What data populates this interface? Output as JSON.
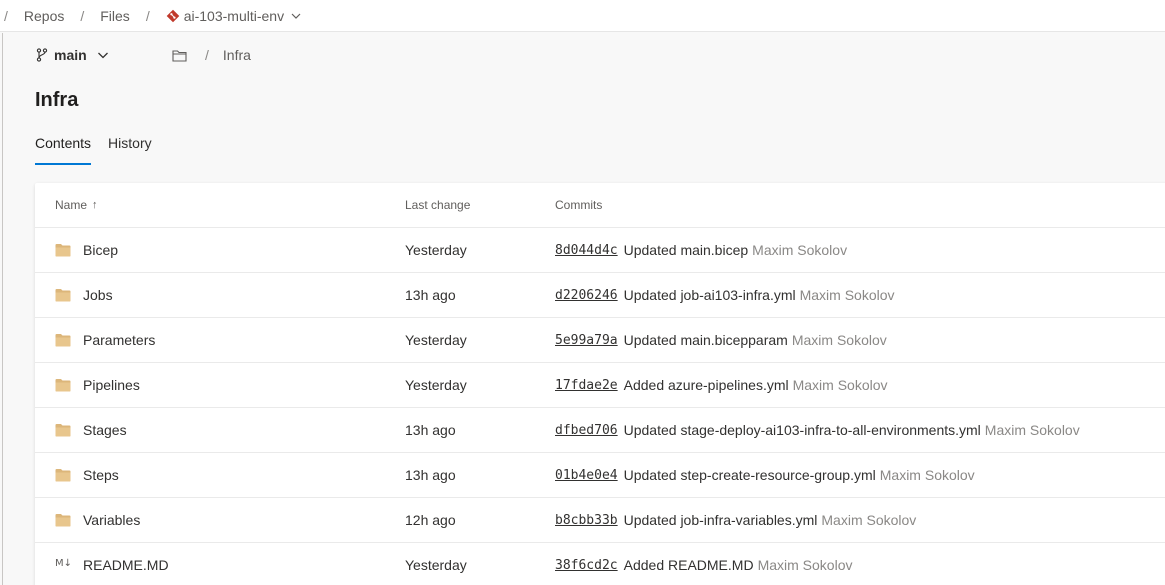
{
  "breadcrumb": {
    "repos": "Repos",
    "files": "Files",
    "repo_name": "ai-103-multi-env"
  },
  "branch": {
    "name": "main"
  },
  "path": {
    "folder": "Infra"
  },
  "page": {
    "title": "Infra"
  },
  "tabs": [
    {
      "label": "Contents",
      "active": true
    },
    {
      "label": "History",
      "active": false
    }
  ],
  "table": {
    "headers": {
      "name": "Name",
      "last_change": "Last change",
      "commits": "Commits"
    },
    "rows": [
      {
        "type": "folder",
        "name": "Bicep",
        "last_change": "Yesterday",
        "commit_id": "8d044d4c",
        "message": "Updated main.bicep",
        "author": "Maxim Sokolov"
      },
      {
        "type": "folder",
        "name": "Jobs",
        "last_change": "13h ago",
        "commit_id": "d2206246",
        "message": "Updated job-ai103-infra.yml",
        "author": "Maxim Sokolov"
      },
      {
        "type": "folder",
        "name": "Parameters",
        "last_change": "Yesterday",
        "commit_id": "5e99a79a",
        "message": "Updated main.bicepparam",
        "author": "Maxim Sokolov"
      },
      {
        "type": "folder",
        "name": "Pipelines",
        "last_change": "Yesterday",
        "commit_id": "17fdae2e",
        "message": "Added azure-pipelines.yml",
        "author": "Maxim Sokolov"
      },
      {
        "type": "folder",
        "name": "Stages",
        "last_change": "13h ago",
        "commit_id": "dfbed706",
        "message": "Updated stage-deploy-ai103-infra-to-all-environments.yml",
        "author": "Maxim Sokolov"
      },
      {
        "type": "folder",
        "name": "Steps",
        "last_change": "13h ago",
        "commit_id": "01b4e0e4",
        "message": "Updated step-create-resource-group.yml",
        "author": "Maxim Sokolov"
      },
      {
        "type": "folder",
        "name": "Variables",
        "last_change": "12h ago",
        "commit_id": "b8cbb33b",
        "message": "Updated job-infra-variables.yml",
        "author": "Maxim Sokolov"
      },
      {
        "type": "markdown",
        "name": "README.MD",
        "last_change": "Yesterday",
        "commit_id": "38f6cd2c",
        "message": "Added README.MD",
        "author": "Maxim Sokolov"
      }
    ]
  },
  "colors": {
    "accent": "#0078d4",
    "folder": "#dcb67a",
    "repo_icon": "#c0392b"
  },
  "icons": {
    "folder": "folder-icon",
    "markdown": "markdown-icon",
    "branch": "branch-icon",
    "repo": "git-repo-icon"
  }
}
